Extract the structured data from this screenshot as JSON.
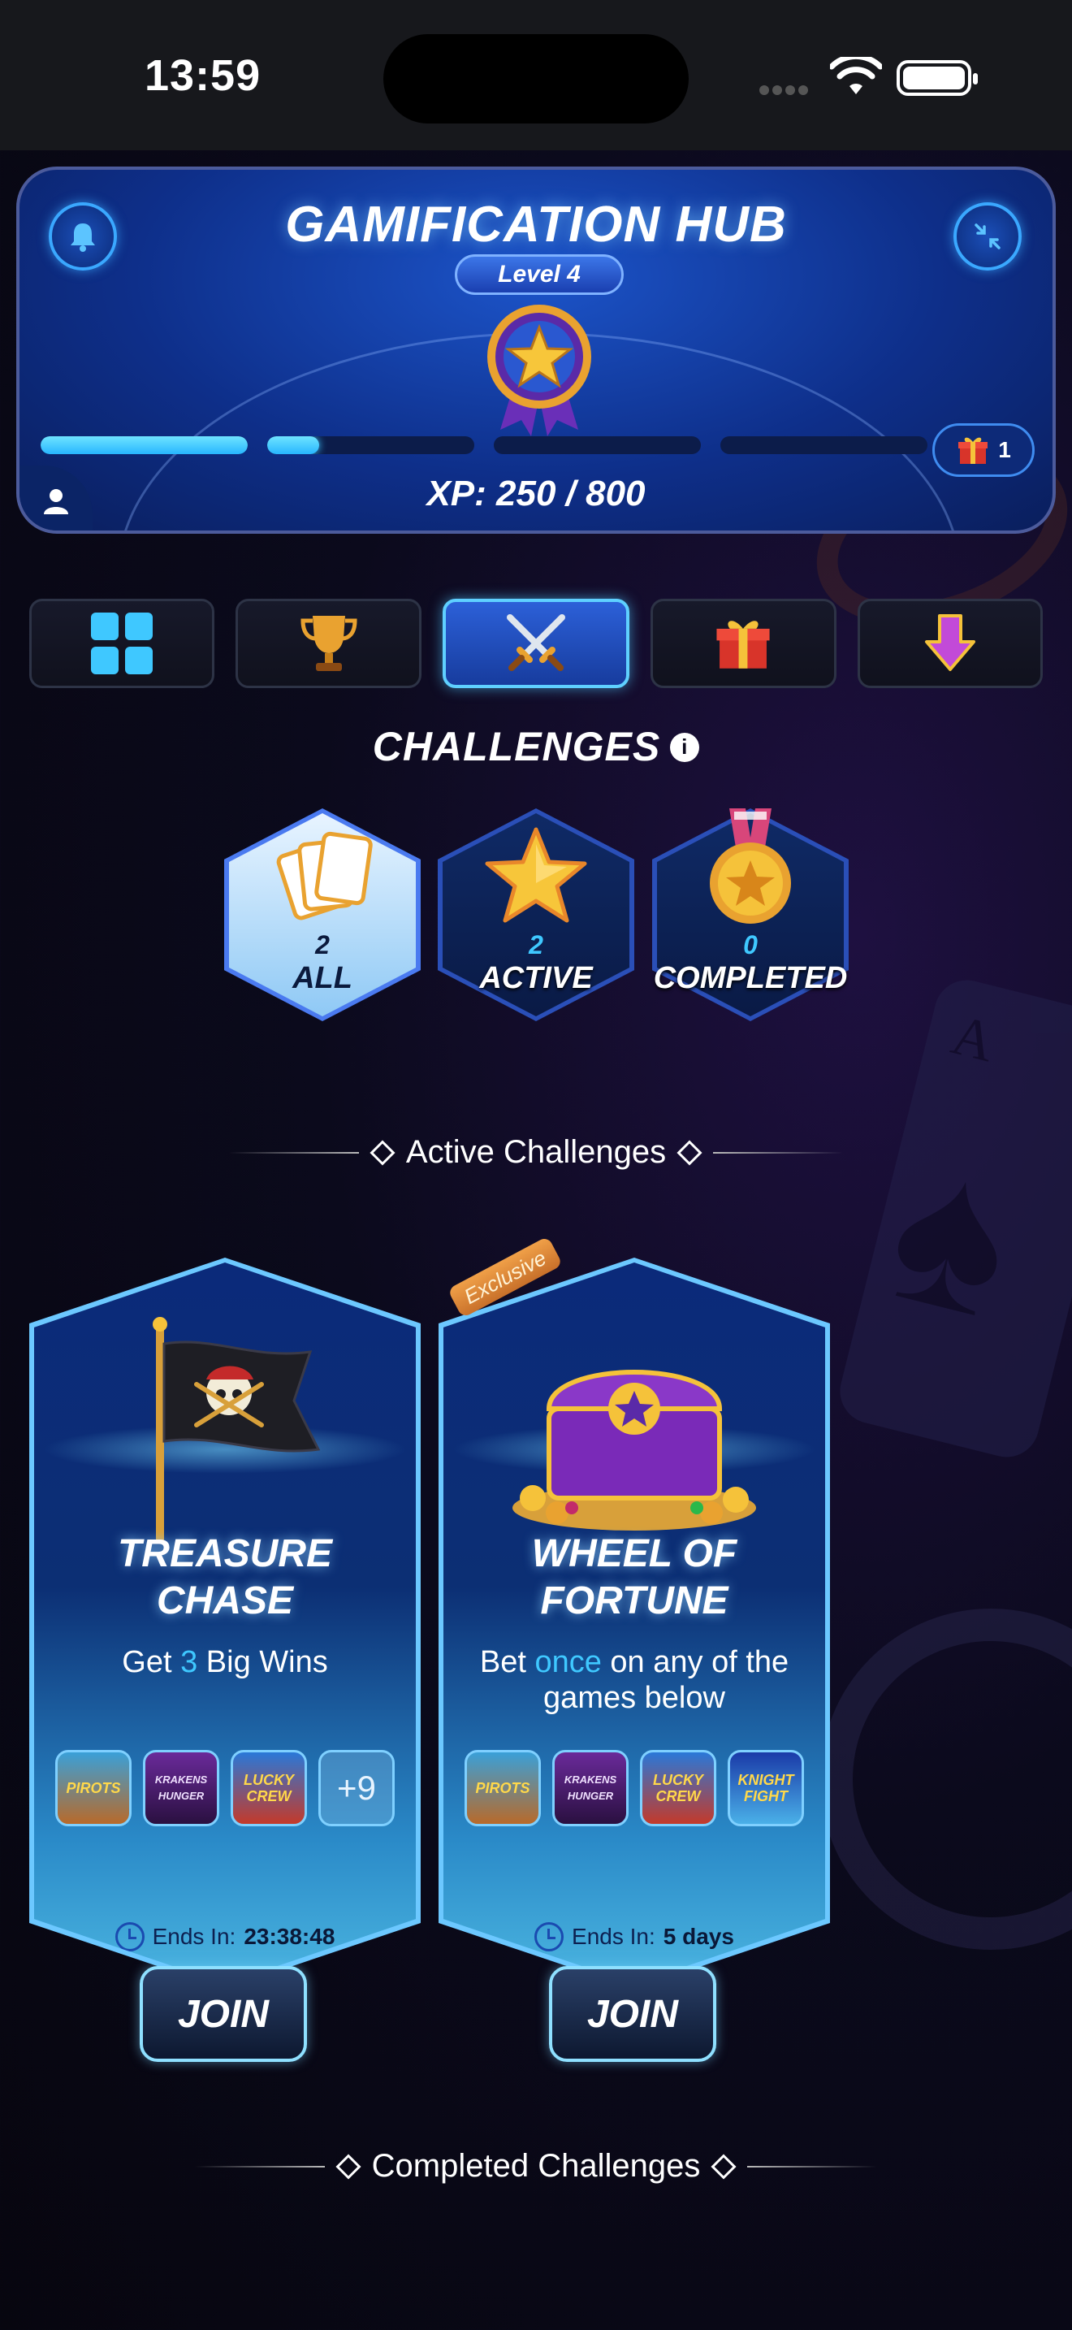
{
  "status_bar": {
    "time": "13:59"
  },
  "hub": {
    "title": "GAMIFICATION HUB",
    "level": "Level 4",
    "xp": "XP: 250 / 800",
    "progress_segments": [
      1.0,
      0.25,
      0.0,
      0.0
    ],
    "gift_count": "1",
    "colors": {
      "accent": "#3fc8ff",
      "panel": "#1c54c9"
    }
  },
  "tabs": [
    {
      "icon": "grid-icon",
      "active": false
    },
    {
      "icon": "trophy-icon",
      "active": false
    },
    {
      "icon": "crossed-swords-icon",
      "active": true
    },
    {
      "icon": "gift-icon",
      "active": false
    },
    {
      "icon": "download-arrow-icon",
      "active": false
    }
  ],
  "challenges": {
    "title": "CHALLENGES",
    "filters": [
      {
        "count": "2",
        "label": "ALL",
        "selected": true,
        "icon": "cards-icon"
      },
      {
        "count": "2",
        "label": "ACTIVE",
        "selected": false,
        "icon": "star-icon"
      },
      {
        "count": "0",
        "label": "COMPLETED",
        "selected": false,
        "icon": "medal-icon"
      }
    ]
  },
  "sections": {
    "active": "Active Challenges",
    "completed": "Completed Challenges"
  },
  "cards": [
    {
      "title": "TREASURE\nCHASE",
      "desc_pre": "Get ",
      "desc_hl": "3",
      "desc_post": " Big Wins",
      "games": [
        "PIROTS",
        "KRAKENS HUNGER",
        "LUCKY CREW"
      ],
      "more": "+9",
      "ends_label": "Ends In:",
      "ends_value": "23:38:48",
      "join": "JOIN",
      "exclusive": ""
    },
    {
      "title": "WHEEL OF\nFORTUNE",
      "desc_pre": "Bet ",
      "desc_hl": "once",
      "desc_post": " on any of the games below",
      "games": [
        "PIROTS",
        "KRAKENS HUNGER",
        "LUCKY CREW",
        "KNIGHT FIGHT"
      ],
      "more": "",
      "ends_label": "Ends In:",
      "ends_value": "5 days",
      "join": "JOIN",
      "exclusive": "Exclusive"
    }
  ]
}
